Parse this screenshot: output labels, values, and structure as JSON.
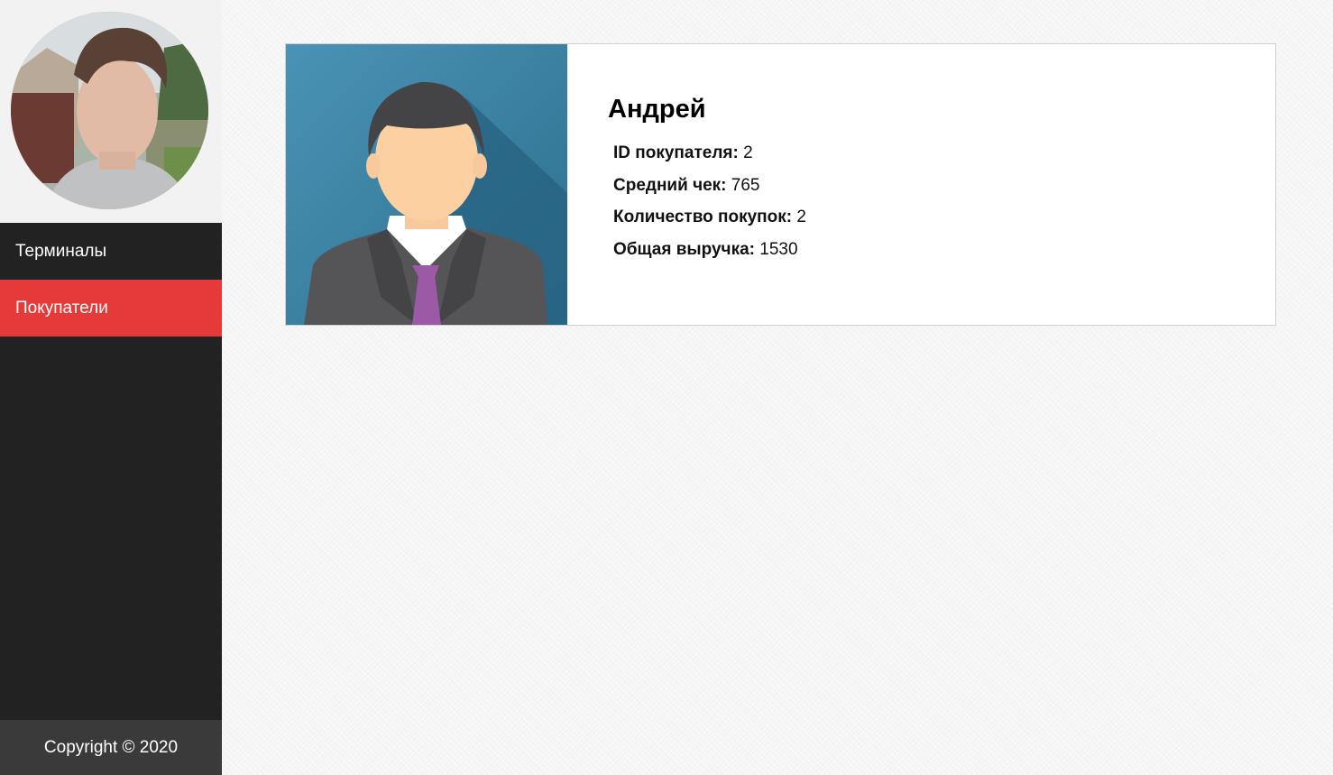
{
  "sidebar": {
    "nav": [
      {
        "label": "Терминалы",
        "active": false
      },
      {
        "label": "Покупатели",
        "active": true
      }
    ],
    "footer": "Copyright © 2020"
  },
  "customer": {
    "name": "Андрей",
    "fields": [
      {
        "label": "ID покупателя:",
        "value": "2"
      },
      {
        "label": "Средний чек:",
        "value": "765"
      },
      {
        "label": "Количество покупок:",
        "value": "2"
      },
      {
        "label": "Общая выручка:",
        "value": "1530"
      }
    ]
  },
  "colors": {
    "sidebar_bg": "#222222",
    "active_nav": "#e53a3a",
    "footer_bg": "#3a3a3a",
    "tie": "#9b59a6",
    "photo_bg": "#3f87a8"
  }
}
